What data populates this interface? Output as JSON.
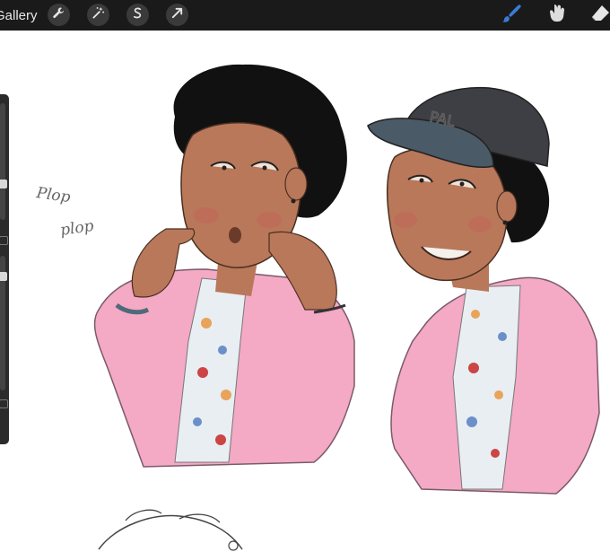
{
  "toolbar": {
    "gallery_label": "Gallery",
    "left_tools": [
      "wrench-icon",
      "magic-wand-icon",
      "selection-icon",
      "transform-arrow-icon"
    ],
    "right_tools": [
      "brush-icon",
      "smudge-icon",
      "eraser-icon"
    ],
    "active_tool": "brush-icon",
    "active_color": "#3a7bd5"
  },
  "sidebar": {
    "brush_size_level": 0.3,
    "opacity_level": 0.6
  },
  "canvas": {
    "handwritten_note_line1": "Plop",
    "handwritten_note_line2": "plop",
    "cap_lettering": "PAL",
    "colors": {
      "skin": "#b9785a",
      "hair": "#111111",
      "jacket": "#f4a9c4",
      "cap": "#4a5a66",
      "shirt": "#e8eef2"
    }
  }
}
